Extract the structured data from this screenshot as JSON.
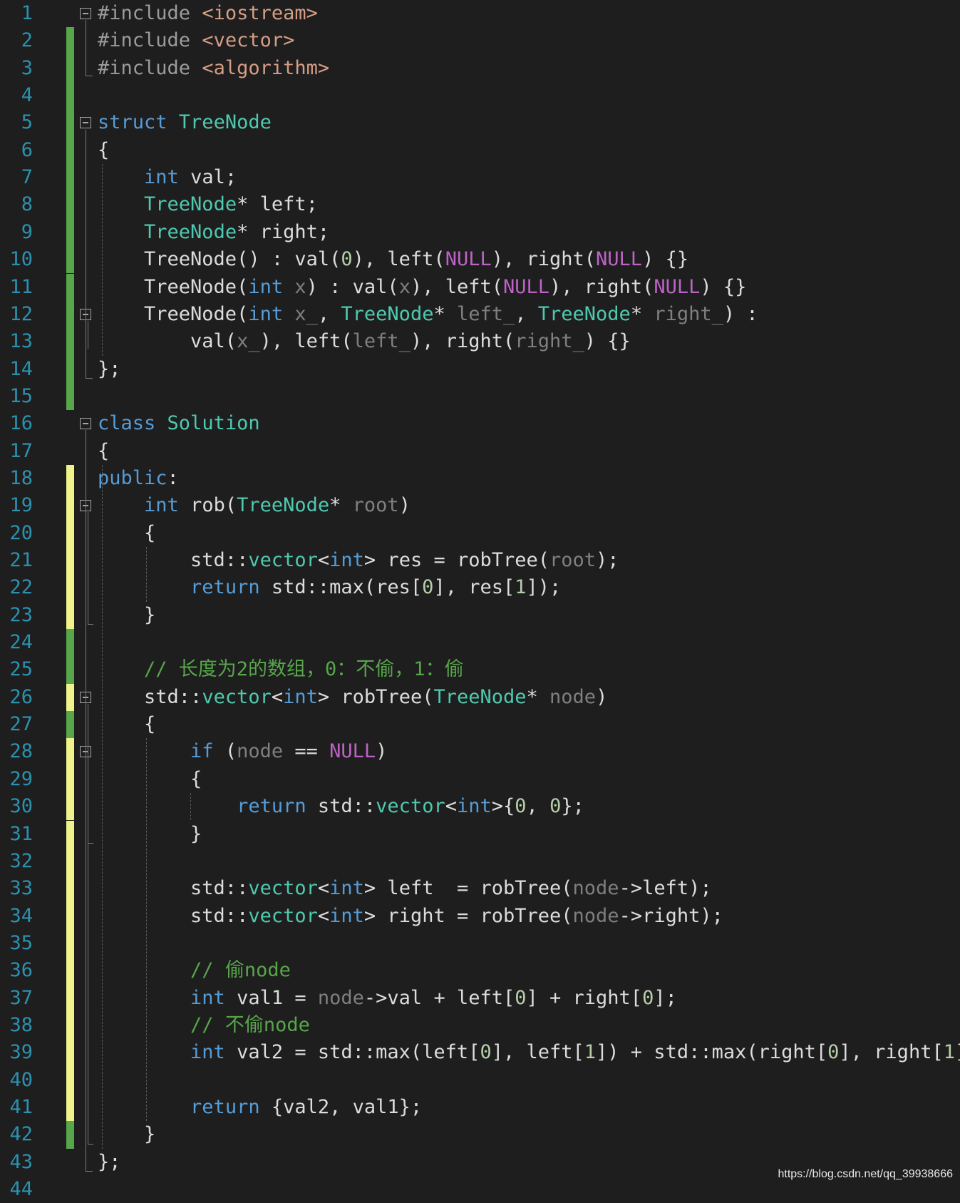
{
  "colors": {
    "background": "#1e1e1e",
    "line_number": "#2b91af",
    "plain": "#dcdcdc",
    "keyword": "#569cd6",
    "type": "#4ec9b0",
    "macro": "#bd63c5",
    "number": "#b5cea8",
    "param": "#7f7f7f",
    "comment": "#57a64a",
    "preproc": "#9b9b9b",
    "string": "#d69d85",
    "bar_saved": "#57a64a",
    "bar_unsaved": "#eff38a"
  },
  "icons": {
    "fold_toggle": "minus-box-icon"
  },
  "lines": [
    {
      "n": "1",
      "bar": "none",
      "fold": true,
      "tokens": [
        [
          "preproc",
          "#include "
        ],
        [
          "string",
          "<iostream>"
        ]
      ]
    },
    {
      "n": "2",
      "bar": "saved",
      "tokens": [
        [
          "preproc",
          "#include "
        ],
        [
          "string",
          "<vector>"
        ]
      ]
    },
    {
      "n": "3",
      "bar": "saved",
      "tokens": [
        [
          "preproc",
          "#include "
        ],
        [
          "string",
          "<algorithm>"
        ]
      ]
    },
    {
      "n": "4",
      "bar": "saved",
      "tokens": []
    },
    {
      "n": "5",
      "bar": "saved",
      "fold": true,
      "tokens": [
        [
          "keyword",
          "struct "
        ],
        [
          "type",
          "TreeNode"
        ]
      ]
    },
    {
      "n": "6",
      "bar": "saved",
      "tokens": [
        [
          "plain",
          "{"
        ]
      ]
    },
    {
      "n": "7",
      "bar": "saved",
      "tokens": [
        [
          "plain",
          "    "
        ],
        [
          "keyword",
          "int"
        ],
        [
          "plain",
          " val;"
        ]
      ]
    },
    {
      "n": "8",
      "bar": "saved",
      "tokens": [
        [
          "plain",
          "    "
        ],
        [
          "type",
          "TreeNode"
        ],
        [
          "plain",
          "* left;"
        ]
      ]
    },
    {
      "n": "9",
      "bar": "saved",
      "tokens": [
        [
          "plain",
          "    "
        ],
        [
          "type",
          "TreeNode"
        ],
        [
          "plain",
          "* right;"
        ]
      ]
    },
    {
      "n": "10",
      "bar": "saved",
      "tokens": [
        [
          "plain",
          "    TreeNode() : val("
        ],
        [
          "number",
          "0"
        ],
        [
          "plain",
          "), left("
        ],
        [
          "macro",
          "NULL"
        ],
        [
          "plain",
          "), right("
        ],
        [
          "macro",
          "NULL"
        ],
        [
          "plain",
          ") {}"
        ]
      ]
    },
    {
      "n": "11",
      "bar": "saved",
      "tokens": [
        [
          "plain",
          "    TreeNode("
        ],
        [
          "keyword",
          "int"
        ],
        [
          "plain",
          " "
        ],
        [
          "param",
          "x"
        ],
        [
          "plain",
          ") : val("
        ],
        [
          "param",
          "x"
        ],
        [
          "plain",
          "), left("
        ],
        [
          "macro",
          "NULL"
        ],
        [
          "plain",
          "), right("
        ],
        [
          "macro",
          "NULL"
        ],
        [
          "plain",
          ") {}"
        ]
      ]
    },
    {
      "n": "12",
      "bar": "saved",
      "fold": true,
      "tokens": [
        [
          "plain",
          "    TreeNode("
        ],
        [
          "keyword",
          "int"
        ],
        [
          "plain",
          " "
        ],
        [
          "param",
          "x_"
        ],
        [
          "plain",
          ", "
        ],
        [
          "type",
          "TreeNode"
        ],
        [
          "plain",
          "* "
        ],
        [
          "param",
          "left_"
        ],
        [
          "plain",
          ", "
        ],
        [
          "type",
          "TreeNode"
        ],
        [
          "plain",
          "* "
        ],
        [
          "param",
          "right_"
        ],
        [
          "plain",
          ") :"
        ]
      ]
    },
    {
      "n": "13",
      "bar": "saved",
      "tokens": [
        [
          "plain",
          "        val("
        ],
        [
          "param",
          "x_"
        ],
        [
          "plain",
          "), left("
        ],
        [
          "param",
          "left_"
        ],
        [
          "plain",
          "), right("
        ],
        [
          "param",
          "right_"
        ],
        [
          "plain",
          ") {}"
        ]
      ]
    },
    {
      "n": "14",
      "bar": "saved",
      "tokens": [
        [
          "plain",
          "};"
        ]
      ]
    },
    {
      "n": "15",
      "bar": "saved",
      "tokens": []
    },
    {
      "n": "16",
      "bar": "none",
      "fold": true,
      "tokens": [
        [
          "keyword",
          "class "
        ],
        [
          "type",
          "Solution"
        ]
      ]
    },
    {
      "n": "17",
      "bar": "none",
      "tokens": [
        [
          "plain",
          "{"
        ]
      ]
    },
    {
      "n": "18",
      "bar": "unsaved",
      "tokens": [
        [
          "keyword",
          "public"
        ],
        [
          "plain",
          ":"
        ]
      ]
    },
    {
      "n": "19",
      "bar": "unsaved",
      "fold": true,
      "tokens": [
        [
          "plain",
          "    "
        ],
        [
          "keyword",
          "int"
        ],
        [
          "plain",
          " rob("
        ],
        [
          "type",
          "TreeNode"
        ],
        [
          "plain",
          "* "
        ],
        [
          "param",
          "root"
        ],
        [
          "plain",
          ")"
        ]
      ]
    },
    {
      "n": "20",
      "bar": "unsaved",
      "tokens": [
        [
          "plain",
          "    {"
        ]
      ]
    },
    {
      "n": "21",
      "bar": "unsaved",
      "tokens": [
        [
          "plain",
          "        std::"
        ],
        [
          "type",
          "vector"
        ],
        [
          "plain",
          "<"
        ],
        [
          "keyword",
          "int"
        ],
        [
          "plain",
          "> res = robTree("
        ],
        [
          "param",
          "root"
        ],
        [
          "plain",
          ");"
        ]
      ]
    },
    {
      "n": "22",
      "bar": "unsaved",
      "tokens": [
        [
          "plain",
          "        "
        ],
        [
          "keyword",
          "return"
        ],
        [
          "plain",
          " std::max(res["
        ],
        [
          "number",
          "0"
        ],
        [
          "plain",
          "], res["
        ],
        [
          "number",
          "1"
        ],
        [
          "plain",
          "]);"
        ]
      ]
    },
    {
      "n": "23",
      "bar": "unsaved",
      "tokens": [
        [
          "plain",
          "    }"
        ]
      ]
    },
    {
      "n": "24",
      "bar": "saved",
      "tokens": []
    },
    {
      "n": "25",
      "bar": "saved",
      "tokens": [
        [
          "plain",
          "    "
        ],
        [
          "comment",
          "// 长度为2的数组，0：不偷，1：偷"
        ]
      ]
    },
    {
      "n": "26",
      "bar": "unsaved",
      "fold": true,
      "tokens": [
        [
          "plain",
          "    std::"
        ],
        [
          "type",
          "vector"
        ],
        [
          "plain",
          "<"
        ],
        [
          "keyword",
          "int"
        ],
        [
          "plain",
          "> robTree("
        ],
        [
          "type",
          "TreeNode"
        ],
        [
          "plain",
          "* "
        ],
        [
          "param",
          "node"
        ],
        [
          "plain",
          ")"
        ]
      ]
    },
    {
      "n": "27",
      "bar": "saved",
      "tokens": [
        [
          "plain",
          "    {"
        ]
      ]
    },
    {
      "n": "28",
      "bar": "unsaved",
      "fold": true,
      "tokens": [
        [
          "plain",
          "        "
        ],
        [
          "keyword",
          "if"
        ],
        [
          "plain",
          " ("
        ],
        [
          "param",
          "node"
        ],
        [
          "plain",
          " == "
        ],
        [
          "macro",
          "NULL"
        ],
        [
          "plain",
          ")"
        ]
      ]
    },
    {
      "n": "29",
      "bar": "unsaved",
      "tokens": [
        [
          "plain",
          "        {"
        ]
      ]
    },
    {
      "n": "30",
      "bar": "unsaved",
      "tokens": [
        [
          "plain",
          "            "
        ],
        [
          "keyword",
          "return"
        ],
        [
          "plain",
          " std::"
        ],
        [
          "type",
          "vector"
        ],
        [
          "plain",
          "<"
        ],
        [
          "keyword",
          "int"
        ],
        [
          "plain",
          ">{"
        ],
        [
          "number",
          "0"
        ],
        [
          "plain",
          ", "
        ],
        [
          "number",
          "0"
        ],
        [
          "plain",
          "};"
        ]
      ]
    },
    {
      "n": "31",
      "bar": "unsaved",
      "tokens": [
        [
          "plain",
          "        }"
        ]
      ]
    },
    {
      "n": "32",
      "bar": "unsaved",
      "tokens": []
    },
    {
      "n": "33",
      "bar": "unsaved",
      "tokens": [
        [
          "plain",
          "        std::"
        ],
        [
          "type",
          "vector"
        ],
        [
          "plain",
          "<"
        ],
        [
          "keyword",
          "int"
        ],
        [
          "plain",
          "> left  = robTree("
        ],
        [
          "param",
          "node"
        ],
        [
          "plain",
          "->left);"
        ]
      ]
    },
    {
      "n": "34",
      "bar": "unsaved",
      "tokens": [
        [
          "plain",
          "        std::"
        ],
        [
          "type",
          "vector"
        ],
        [
          "plain",
          "<"
        ],
        [
          "keyword",
          "int"
        ],
        [
          "plain",
          "> right = robTree("
        ],
        [
          "param",
          "node"
        ],
        [
          "plain",
          "->right);"
        ]
      ]
    },
    {
      "n": "35",
      "bar": "unsaved",
      "tokens": []
    },
    {
      "n": "36",
      "bar": "unsaved",
      "tokens": [
        [
          "plain",
          "        "
        ],
        [
          "comment",
          "// 偷node"
        ]
      ]
    },
    {
      "n": "37",
      "bar": "unsaved",
      "tokens": [
        [
          "plain",
          "        "
        ],
        [
          "keyword",
          "int"
        ],
        [
          "plain",
          " val1 = "
        ],
        [
          "param",
          "node"
        ],
        [
          "plain",
          "->val + left["
        ],
        [
          "number",
          "0"
        ],
        [
          "plain",
          "] + right["
        ],
        [
          "number",
          "0"
        ],
        [
          "plain",
          "];"
        ]
      ]
    },
    {
      "n": "38",
      "bar": "unsaved",
      "tokens": [
        [
          "plain",
          "        "
        ],
        [
          "comment",
          "// 不偷node"
        ]
      ]
    },
    {
      "n": "39",
      "bar": "unsaved",
      "tokens": [
        [
          "plain",
          "        "
        ],
        [
          "keyword",
          "int"
        ],
        [
          "plain",
          " val2 = std::max(left["
        ],
        [
          "number",
          "0"
        ],
        [
          "plain",
          "], left["
        ],
        [
          "number",
          "1"
        ],
        [
          "plain",
          "]) + std::max(right["
        ],
        [
          "number",
          "0"
        ],
        [
          "plain",
          "], right["
        ],
        [
          "number",
          "1"
        ],
        [
          "plain",
          "]);"
        ]
      ]
    },
    {
      "n": "40",
      "bar": "unsaved",
      "tokens": []
    },
    {
      "n": "41",
      "bar": "unsaved",
      "tokens": [
        [
          "plain",
          "        "
        ],
        [
          "keyword",
          "return"
        ],
        [
          "plain",
          " {val2, val1};"
        ]
      ]
    },
    {
      "n": "42",
      "bar": "saved",
      "tokens": [
        [
          "plain",
          "    }"
        ]
      ]
    },
    {
      "n": "43",
      "bar": "none",
      "tokens": [
        [
          "plain",
          "};"
        ]
      ]
    },
    {
      "n": "44",
      "bar": "none",
      "tokens": []
    }
  ],
  "watermark": "https://blog.csdn.net/qq_39938666"
}
